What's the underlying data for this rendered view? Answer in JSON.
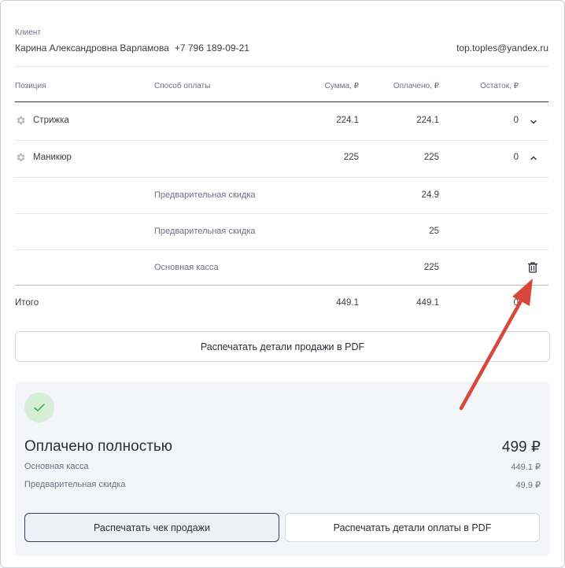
{
  "client": {
    "label": "Клиент",
    "name": "Карина Александровна Варламова",
    "phone": "+7 796 189-09-21",
    "email": "top.toples@yandex.ru"
  },
  "table": {
    "headers": {
      "position": "Позиция",
      "payment_method": "Способ оплаты",
      "sum": "Сумма, ₽",
      "paid": "Оплачено, ₽",
      "remainder": "Остаток, ₽"
    },
    "rows": [
      {
        "name": "Стрижка",
        "sum": "224.1",
        "paid": "224.1",
        "remainder": "0",
        "expanded": false
      },
      {
        "name": "Маникюр",
        "sum": "225",
        "paid": "225",
        "remainder": "0",
        "expanded": true
      }
    ],
    "subrows": [
      {
        "method": "Предварительная скидка",
        "paid": "24.9"
      },
      {
        "method": "Предварительная скидка",
        "paid": "25"
      },
      {
        "method": "Основная касса",
        "paid": "225"
      }
    ],
    "total": {
      "label": "Итого",
      "sum": "449.1",
      "paid": "449.1",
      "remainder": "0"
    }
  },
  "print_sale_details_pdf": "Распечатать детали продажи в PDF",
  "payment_summary": {
    "status": "Оплачено полностью",
    "total": "499 ₽",
    "breakdown": [
      {
        "label": "Основная касса",
        "value": "449.1 ₽"
      },
      {
        "label": "Предварительная скидка",
        "value": "49.9 ₽"
      }
    ],
    "print_receipt": "Распечатать чек продажи",
    "print_payment_pdf": "Распечатать детали оплаты в PDF"
  },
  "colors": {
    "annotation_arrow": "#d9473b",
    "success_bg": "#d4efd6",
    "success_check": "#3aa34a"
  },
  "icons": {
    "row_icon": "gear-icon",
    "collapsed": "chevron-down-icon",
    "expanded": "chevron-up-icon",
    "delete": "trash-icon",
    "status": "check-icon"
  }
}
